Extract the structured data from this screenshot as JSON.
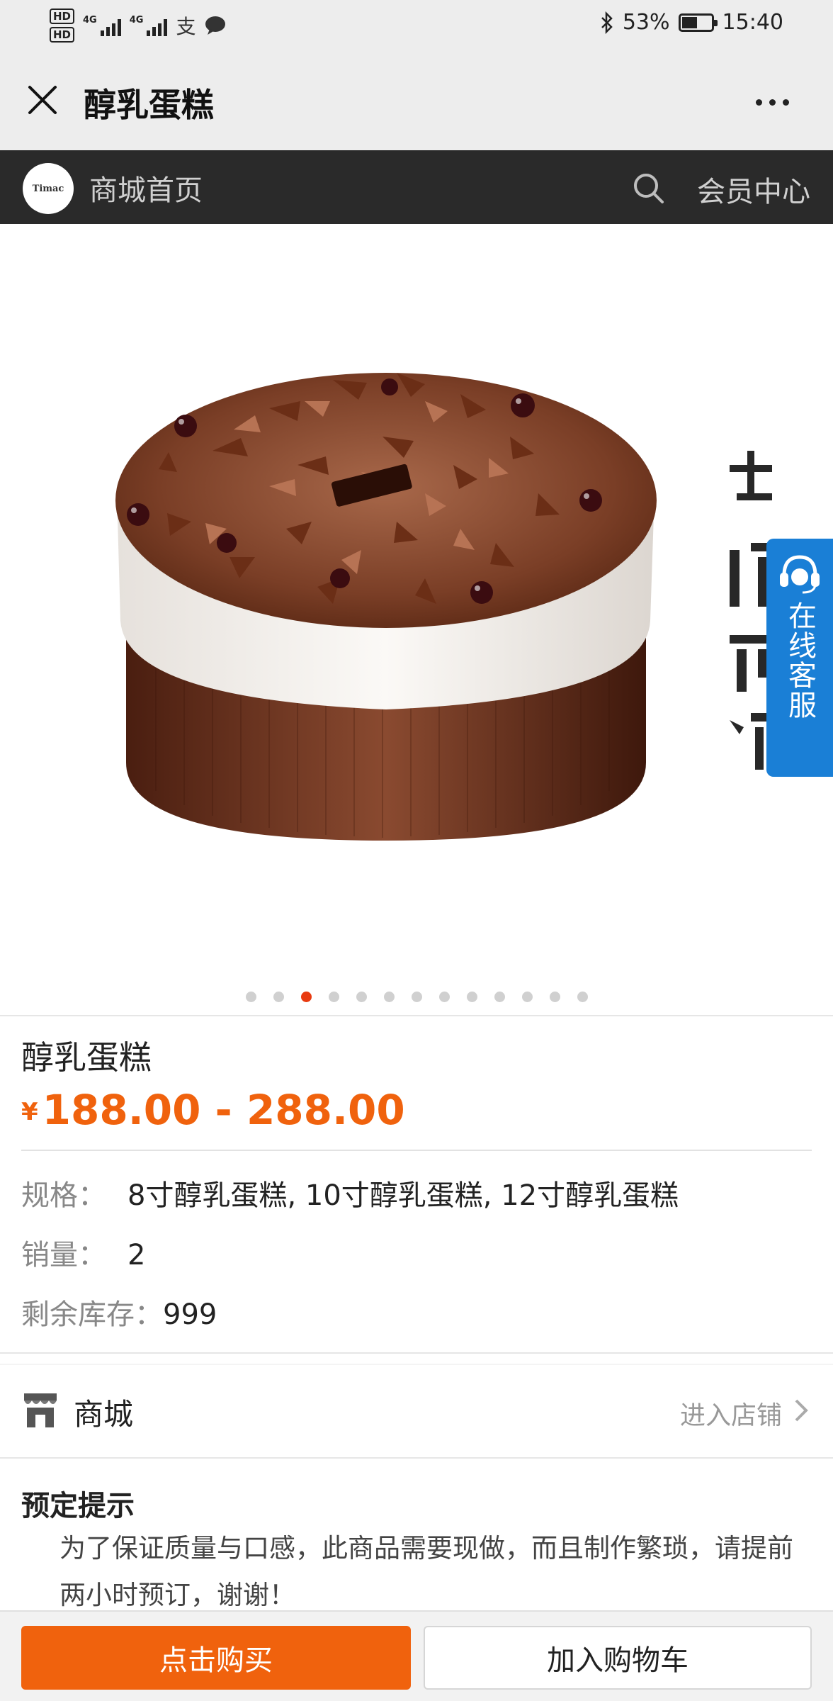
{
  "status_bar": {
    "hd1": "HD",
    "hd2": "HD",
    "net1": "4G",
    "net2": "4G",
    "alipay_glyph": "支",
    "battery_percent": "53%",
    "battery_level": 0.53,
    "time": "15:40",
    "icons": [
      "hd-icon",
      "signal-icon",
      "alipay-icon",
      "message-icon",
      "bluetooth-icon",
      "battery-icon"
    ]
  },
  "titlebar": {
    "title": "醇乳蛋糕",
    "close_icon": "close-icon",
    "more_icon": "more-icon"
  },
  "mall_nav": {
    "logo_text": "Timac",
    "home_label": "商城首页",
    "member_label": "会员中心",
    "search_icon": "search-icon"
  },
  "gallery": {
    "image_count": 13,
    "active_index": 2,
    "side_text": "巧\n脂\n露\n清"
  },
  "customer_service": {
    "label": "在线客服"
  },
  "product": {
    "name": "醇乳蛋糕",
    "currency": "¥",
    "price_range": "188.00 - 288.00",
    "spec_label": "规格：",
    "spec_value": "8寸醇乳蛋糕, 10寸醇乳蛋糕, 12寸醇乳蛋糕",
    "sales_label": "销量：",
    "sales_value": "2",
    "stock_label": "剩余库存：",
    "stock_value": "999"
  },
  "shop": {
    "name": "商城",
    "enter_label": "进入店铺"
  },
  "notice": {
    "title": "预定提示",
    "body": "为了保证质量与口感，此商品需要现做，而且制作繁琐，请提前两小时预订，谢谢！"
  },
  "actions": {
    "buy_label": "点击购买",
    "cart_label": "加入购物车"
  },
  "colors": {
    "accent": "#f0620d",
    "nav_bg": "#2a2a2a",
    "cs_blue": "#1a7fd6",
    "dot_active": "#e83a10"
  }
}
